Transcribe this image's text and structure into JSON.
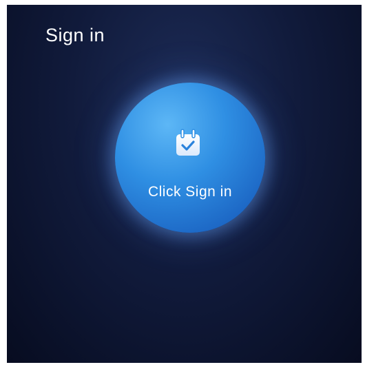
{
  "header": {
    "title": "Sign in"
  },
  "signin_button": {
    "label": "Click Sign in",
    "icon": "calendar-check-icon"
  },
  "colors": {
    "background_top": "#1d2c57",
    "background_bottom": "#070c20",
    "button_light": "#5db7f6",
    "button_dark": "#1758ae",
    "text": "#ffffff"
  }
}
